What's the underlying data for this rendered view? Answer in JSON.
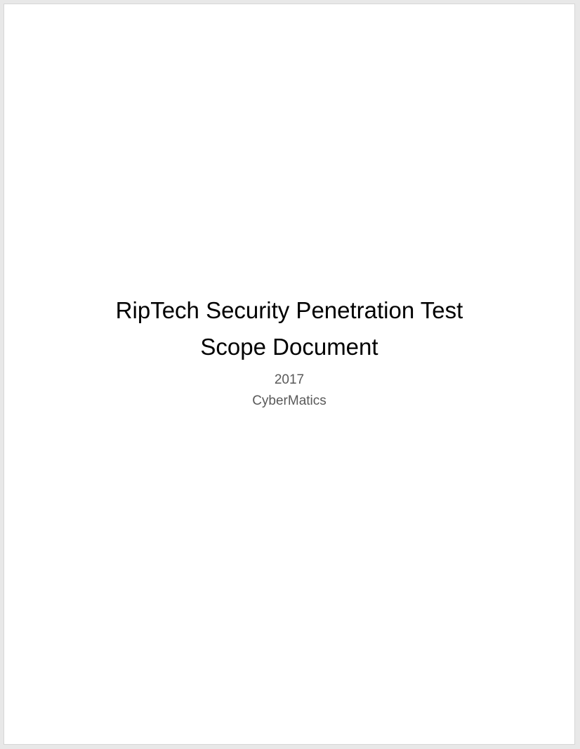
{
  "document": {
    "title_line_1": "RipTech Security Penetration Test",
    "title_line_2": "Scope Document",
    "year": "2017",
    "company": "CyberMatics"
  },
  "colors": {
    "title": "#000000",
    "subtitle": "#595959",
    "page_background": "#ffffff"
  }
}
